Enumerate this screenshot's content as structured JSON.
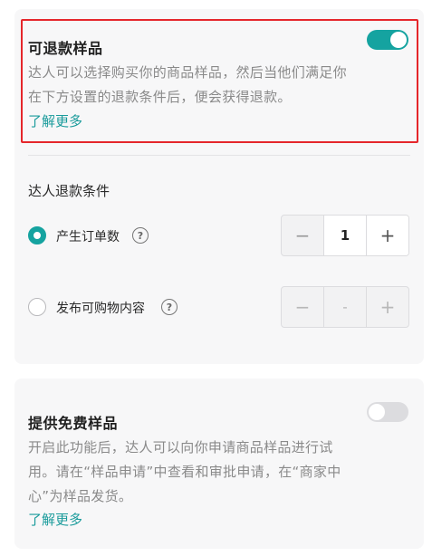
{
  "refund_sample": {
    "title": "可退款样品",
    "toggle_on": true,
    "description_line1": "达人可以选择购买你的商品样品，然后当他们满足你",
    "description_line2": "在下方设置的退款条件后，便会获得退款。",
    "learn_more": "了解更多"
  },
  "conditions": {
    "title": "达人退款条件",
    "options": [
      {
        "label": "产生订单数",
        "selected": true,
        "minus": "−",
        "value": "1",
        "plus": "+"
      },
      {
        "label": "发布可购物内容",
        "selected": false,
        "minus": "−",
        "value": "-",
        "plus": "+"
      }
    ]
  },
  "free_sample": {
    "title": "提供免费样品",
    "toggle_on": false,
    "description_line1": "开启此功能后，达人可以向你申请商品样品进行试",
    "description_line2": "用。请在“样品申请”中查看和审批申请，在“商家中",
    "description_line3": "心”为样品发货。",
    "learn_more": "了解更多"
  },
  "colors": {
    "accent": "#15a3a0",
    "highlight_border": "#e5262b",
    "link": "#1a9b9b"
  }
}
